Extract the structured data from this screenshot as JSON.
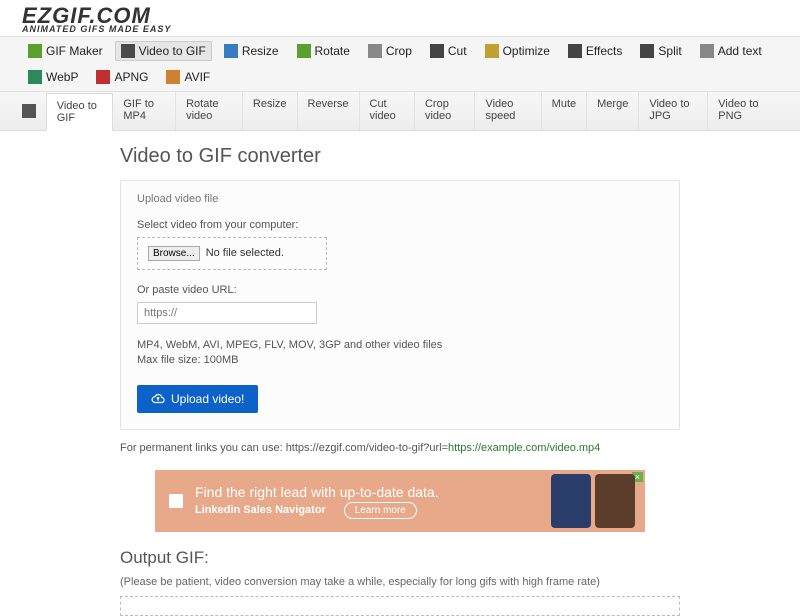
{
  "logo": {
    "main": "EZGIF.COM",
    "tagline": "ANIMATED GIFS MADE EASY"
  },
  "nav_primary": [
    {
      "id": "gif-maker",
      "label": "GIF Maker",
      "iconColor": "#5aa02c"
    },
    {
      "id": "video-to-gif",
      "label": "Video to GIF",
      "iconColor": "#4a4a4a",
      "active": true
    },
    {
      "id": "resize",
      "label": "Resize",
      "iconColor": "#3a7bbf"
    },
    {
      "id": "rotate",
      "label": "Rotate",
      "iconColor": "#5aa02c"
    },
    {
      "id": "crop",
      "label": "Crop",
      "iconColor": "#888"
    },
    {
      "id": "cut",
      "label": "Cut",
      "iconColor": "#444"
    },
    {
      "id": "optimize",
      "label": "Optimize",
      "iconColor": "#c0a030"
    },
    {
      "id": "effects",
      "label": "Effects",
      "iconColor": "#444"
    },
    {
      "id": "split",
      "label": "Split",
      "iconColor": "#444"
    },
    {
      "id": "add-text",
      "label": "Add text",
      "iconColor": "#888"
    },
    {
      "id": "webp",
      "label": "WebP",
      "iconColor": "#2a8a5a"
    },
    {
      "id": "apng",
      "label": "APNG",
      "iconColor": "#c03030"
    },
    {
      "id": "avif",
      "label": "AVIF",
      "iconColor": "#d08030"
    }
  ],
  "nav_secondary": [
    {
      "id": "video-to-gif-tab",
      "label": "Video to GIF",
      "active": true
    },
    {
      "id": "gif-to-mp4",
      "label": "GIF to MP4"
    },
    {
      "id": "rotate-video",
      "label": "Rotate video"
    },
    {
      "id": "resize-video",
      "label": "Resize"
    },
    {
      "id": "reverse",
      "label": "Reverse"
    },
    {
      "id": "cut-video",
      "label": "Cut video"
    },
    {
      "id": "crop-video",
      "label": "Crop video"
    },
    {
      "id": "video-speed",
      "label": "Video speed"
    },
    {
      "id": "mute",
      "label": "Mute"
    },
    {
      "id": "merge",
      "label": "Merge"
    },
    {
      "id": "video-to-jpg",
      "label": "Video to JPG"
    },
    {
      "id": "video-to-png",
      "label": "Video to PNG"
    }
  ],
  "page": {
    "title": "Video to GIF converter",
    "legend": "Upload video file",
    "select_label": "Select video from your computer:",
    "browse": "Browse...",
    "no_file": "No file selected.",
    "url_label": "Or paste video URL:",
    "url_placeholder": "https://",
    "formats_line": "MP4, WebM, AVI, MPEG, FLV, MOV, 3GP and other video files",
    "maxsize_line": "Max file size: 100MB",
    "upload_btn": "Upload video!",
    "perm_prefix": "For permanent links you can use: https://ezgif.com/video-to-gif?url=",
    "perm_link": "https://example.com/video.mp4",
    "output_heading": "Output GIF:",
    "patience_note": "(Please be patient, video conversion may take a while, especially for long gifs with high frame rate)"
  },
  "ad": {
    "headline": "Find the right lead with up-to-date data.",
    "brand": "Linkedin Sales Navigator",
    "cta": "Learn more",
    "close": "×"
  }
}
